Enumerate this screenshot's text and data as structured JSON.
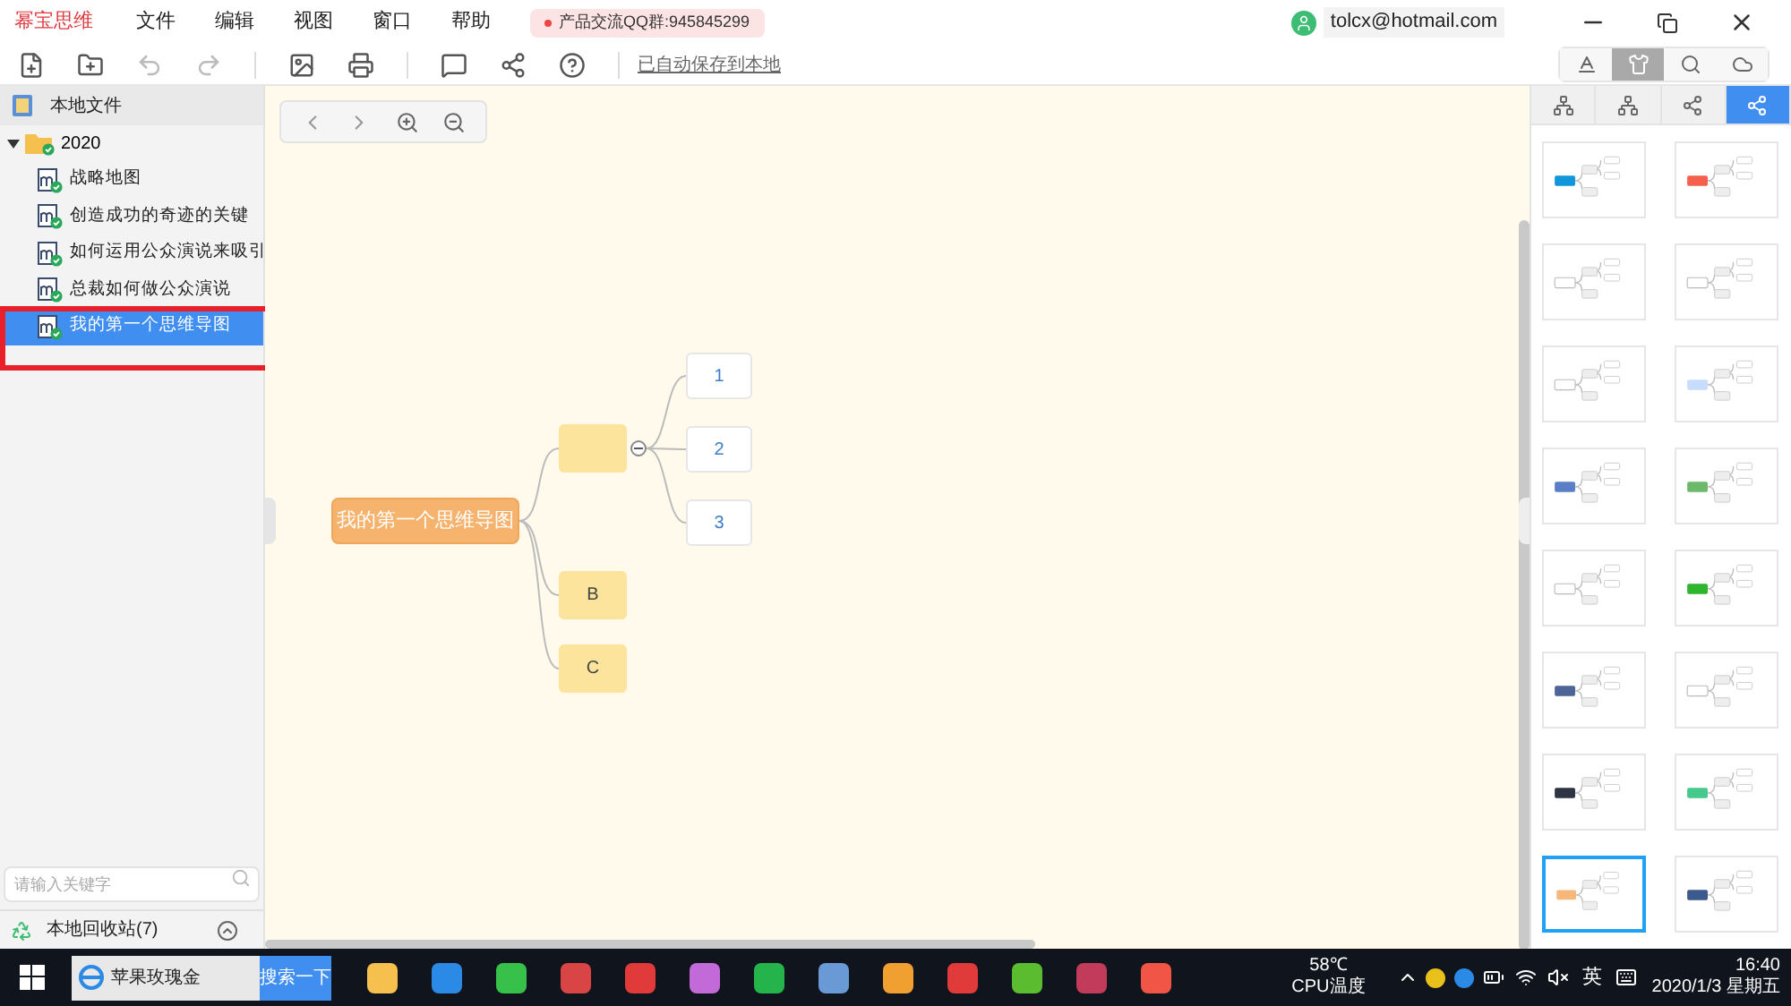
{
  "app": {
    "name": "幂宝思维",
    "menu": [
      "文件",
      "编辑",
      "视图",
      "窗口",
      "帮助"
    ],
    "notice": "产品交流QQ群:945845299",
    "account": "tolcx@hotmail.com"
  },
  "toolbar": {
    "save_status": "已自动保存到本地"
  },
  "sidebar": {
    "title": "本地文件",
    "tree": [
      {
        "label": "2020",
        "expanded": true,
        "selected": false,
        "children": [
          {
            "label": "战略地图",
            "selected": false
          },
          {
            "label": "创造成功的奇迹的关键",
            "selected": false
          },
          {
            "label": "如何运用公众演说来吸引",
            "selected": false
          },
          {
            "label": "总裁如何做公众演说",
            "selected": false
          },
          {
            "label": "我的第一个思维导图",
            "selected": true
          }
        ]
      }
    ],
    "search": {
      "placeholder": "请输入关键字"
    },
    "recycle": "本地回收站(7)"
  },
  "mindmap": {
    "root": "我的第一个思维导图",
    "children": [
      {
        "expanded": true,
        "children": [
          {
            "text": "1"
          },
          {
            "text": "2"
          },
          {
            "text": "3"
          }
        ]
      },
      {
        "text": "B"
      },
      {
        "text": "C"
      }
    ]
  },
  "panel": {
    "tabs": [
      {
        "kind": "text",
        "selected": false
      },
      {
        "kind": "style",
        "selected": true
      },
      {
        "kind": "search",
        "selected": false
      },
      {
        "kind": "cloud",
        "selected": false
      }
    ],
    "layouts": [
      {
        "selected": false
      },
      {
        "selected": false
      },
      {
        "selected": false
      },
      {
        "selected": true
      }
    ],
    "themes": [
      {
        "color": "#1296db",
        "selected": false
      },
      {
        "color": "#f5604c",
        "selected": false
      },
      {
        "color": "#ffffff",
        "selected": false
      },
      {
        "color": "#ffffff",
        "selected": false
      },
      {
        "color": "#ffffff",
        "selected": false
      },
      {
        "color": "#c8dcff",
        "selected": false
      },
      {
        "color": "#5b7fc7",
        "selected": false
      },
      {
        "color": "#6cb96c",
        "selected": false
      },
      {
        "color": "#ffffff",
        "selected": false
      },
      {
        "color": "#2db52d",
        "selected": false
      },
      {
        "color": "#4e6496",
        "selected": false
      },
      {
        "color": "#ffffff",
        "selected": false
      },
      {
        "color": "#2f3542",
        "selected": false
      },
      {
        "color": "#46c98c",
        "selected": false
      },
      {
        "color": "#f5b87a",
        "selected": true
      },
      {
        "color": "#3d5a8f",
        "selected": false
      }
    ]
  },
  "taskbar": {
    "search_text": "苹果玫瑰金",
    "search_button": "搜索一下",
    "cpu_temp": "58℃",
    "cpu_label": "CPU温度",
    "ime": "英",
    "time": "16:40",
    "date": "2020/1/3 星期五"
  }
}
